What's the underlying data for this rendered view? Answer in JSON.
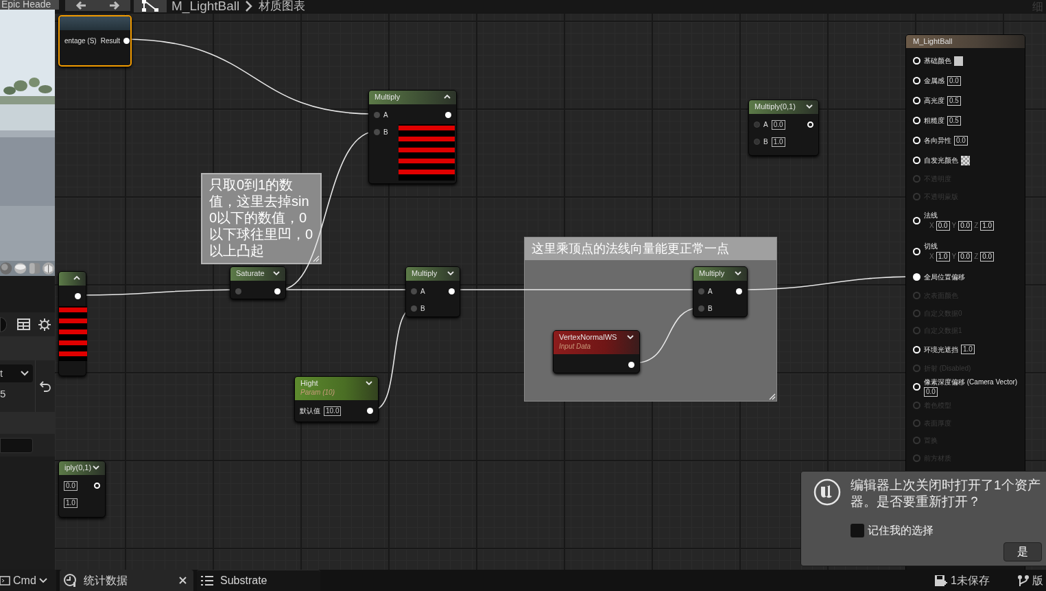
{
  "top_bar": {
    "left_title": "Epic Heade",
    "breadcrumb": [
      "M_LightBall",
      "材质图表"
    ],
    "right_text": "细"
  },
  "left_panel": {
    "dropdown_value": "t",
    "number": "5"
  },
  "comments": [
    {
      "text": "只取0到1的数值，这里去掉sin0以下的数值，0以下球往里凹，0以上凸起"
    },
    {
      "title": "这里乘顶点的法线向量能更正常一点"
    }
  ],
  "nodes": [
    {
      "kind": "function",
      "selected": true,
      "rows": [
        {
          "in_label": "entage (S)",
          "out_label": "Result",
          "out_connected": true
        }
      ]
    },
    {
      "kind": "math",
      "title": "Multiply",
      "selected": false,
      "preview_expanded": true,
      "rows": [
        {
          "in_label": "A",
          "in_connected": true,
          "out_connected": true
        },
        {
          "in_label": "B",
          "in_connected": true
        }
      ]
    },
    {
      "kind": "math",
      "title": "Multiply(0,1)",
      "selected": false,
      "preview_expanded": false,
      "rows": [
        {
          "in_label": "A",
          "in_connected": false,
          "in_value": "0.0",
          "out_connected": false
        },
        {
          "in_label": "B",
          "in_connected": false,
          "in_value": "1.0"
        }
      ]
    },
    {
      "kind": "math",
      "selected": false,
      "preview_expanded": true,
      "rows": [
        {
          "out_connected": true
        }
      ]
    },
    {
      "kind": "math",
      "title": "Saturate",
      "selected": false,
      "preview_expanded": false,
      "rows": [
        {
          "in_connected": true,
          "out_connected": true
        }
      ]
    },
    {
      "kind": "math",
      "title": "Multiply",
      "selected": false,
      "preview_expanded": false,
      "rows": [
        {
          "in_label": "A",
          "in_connected": true,
          "out_connected": true
        },
        {
          "in_label": "B",
          "in_connected": true
        }
      ]
    },
    {
      "kind": "param",
      "title": "Hight",
      "subtitle": "Param (10)",
      "selected": false,
      "preview_expanded": false,
      "rows": [
        {
          "in_label": "默认值",
          "in_value": "10.0",
          "out_connected": true
        }
      ]
    },
    {
      "kind": "input",
      "title": "VertexNormalWS",
      "subtitle": "Input Data",
      "selected": false,
      "preview_expanded": false,
      "rows": [
        {
          "out_connected": true
        }
      ]
    },
    {
      "kind": "math",
      "title": "Multiply",
      "selected": false,
      "preview_expanded": false,
      "rows": [
        {
          "in_label": "A",
          "in_connected": true,
          "out_connected": true
        },
        {
          "in_label": "B",
          "in_connected": true
        }
      ]
    },
    {
      "kind": "math",
      "title": "iply(0,1)",
      "selected": false,
      "preview_expanded": false,
      "rows": [
        {
          "in_value": "0.0",
          "out_connected": false
        },
        {
          "in_value": "1.0"
        }
      ]
    }
  ],
  "result_node": {
    "title": "M_LightBall",
    "pins": [
      {
        "label": "基础颜色",
        "enabled": true,
        "connected": false,
        "kind": "swatch"
      },
      {
        "label": "金属感",
        "enabled": true,
        "connected": false,
        "kind": "scalar",
        "value": "0.0"
      },
      {
        "label": "高光度",
        "enabled": true,
        "connected": false,
        "kind": "scalar",
        "value": "0.5"
      },
      {
        "label": "粗糙度",
        "enabled": true,
        "connected": false,
        "kind": "scalar",
        "value": "0.5"
      },
      {
        "label": "各向异性",
        "enabled": true,
        "connected": false,
        "kind": "scalar",
        "value": "0.0"
      },
      {
        "label": "自发光颜色",
        "enabled": true,
        "connected": false,
        "kind": "checker"
      },
      {
        "label": "不透明度",
        "enabled": false,
        "connected": false,
        "kind": "plain"
      },
      {
        "label": "不透明蒙版",
        "enabled": false,
        "connected": false,
        "kind": "plain"
      },
      {
        "label": "法线",
        "enabled": true,
        "connected": false,
        "kind": "vector",
        "values": [
          {
            "axis": "X",
            "value": "0.0"
          },
          {
            "axis": "Y",
            "value": "0.0"
          },
          {
            "axis": "Z",
            "value": "1.0"
          }
        ]
      },
      {
        "label": "切线",
        "enabled": true,
        "connected": false,
        "kind": "vector",
        "values": [
          {
            "axis": "X",
            "value": "1.0"
          },
          {
            "axis": "Y",
            "value": "0.0"
          },
          {
            "axis": "Z",
            "value": "0.0"
          }
        ]
      },
      {
        "label": "全局位置偏移",
        "enabled": true,
        "connected": true,
        "kind": "plain"
      },
      {
        "label": "次表面颜色",
        "enabled": false,
        "connected": false,
        "kind": "plain"
      },
      {
        "label": "自定义数据0",
        "enabled": false,
        "connected": false,
        "kind": "plain"
      },
      {
        "label": "自定义数据1",
        "enabled": false,
        "connected": false,
        "kind": "plain"
      },
      {
        "label": "环境光遮挡",
        "enabled": true,
        "connected": false,
        "kind": "scalar",
        "value": "1.0"
      },
      {
        "label": "折射 (Disabled)",
        "enabled": false,
        "connected": false,
        "kind": "plain"
      },
      {
        "label": "像素深度偏移 (Camera Vector)",
        "enabled": true,
        "connected": false,
        "kind": "scalar",
        "value": "0.0"
      },
      {
        "label": "着色模型",
        "enabled": false,
        "connected": false,
        "kind": "plain"
      },
      {
        "label": "表面厚度",
        "enabled": false,
        "connected": false,
        "kind": "plain"
      },
      {
        "label": "置换",
        "enabled": false,
        "connected": false,
        "kind": "plain"
      },
      {
        "label": "前方材质",
        "enabled": false,
        "connected": false,
        "kind": "plain"
      }
    ]
  },
  "dialog": {
    "lines": [
      "编辑器上次关闭时打开了1个资产",
      "器。是否要重新打开？"
    ],
    "checkbox": {
      "label": "记住我的选择",
      "checked": false
    },
    "button": "是"
  },
  "bottom_bar": {
    "console": "Cmd",
    "tabs": [
      {
        "label": "统计数据",
        "selected": true,
        "closable": true
      },
      {
        "label": "Substrate",
        "selected": false,
        "closable": false
      }
    ],
    "unsaved": "1未保存",
    "version": "版"
  }
}
